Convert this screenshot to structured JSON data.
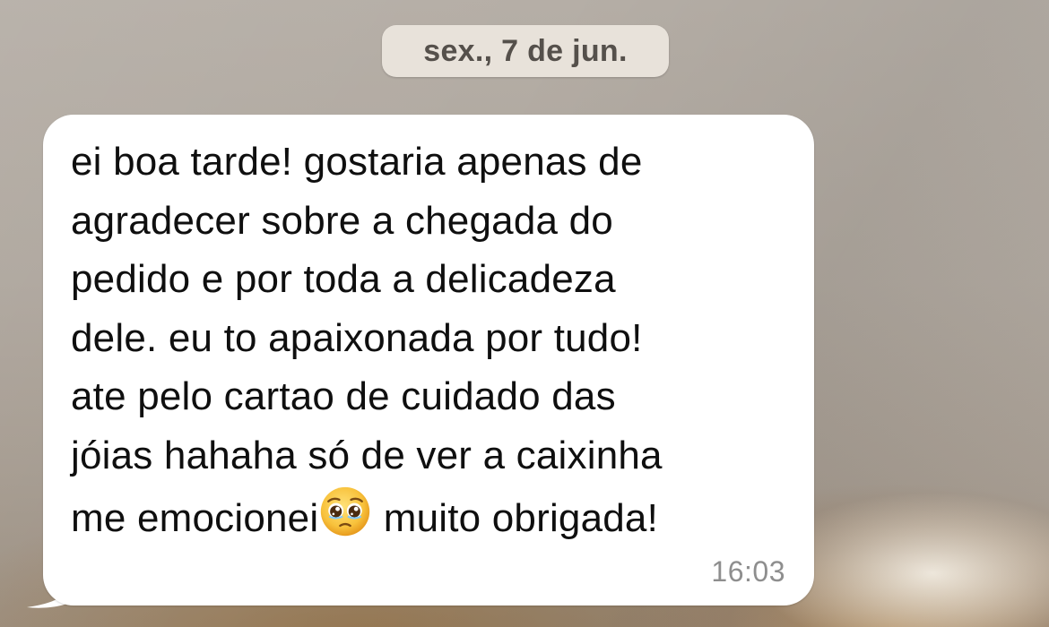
{
  "date_separator": {
    "label": "sex., 7 de jun."
  },
  "message": {
    "lines": [
      "ei boa tarde! gostaria apenas de",
      "agradecer sobre a chegada do",
      "pedido e por toda a delicadeza",
      "dele. eu to apaixonada por tudo!",
      "ate pelo cartao de cuidado das",
      "jóias hahaha só de ver a caixinha"
    ],
    "last_line_before_emoji": "me emocionei",
    "emoji": "pleading-face-emoji",
    "last_line_after_emoji": " muito obrigada!",
    "time": "16:03"
  },
  "colors": {
    "bubble": "#ffffff",
    "date_pill": "#e8e2da",
    "timestamp": "#8e8e8e",
    "text": "#0f0f0f"
  }
}
